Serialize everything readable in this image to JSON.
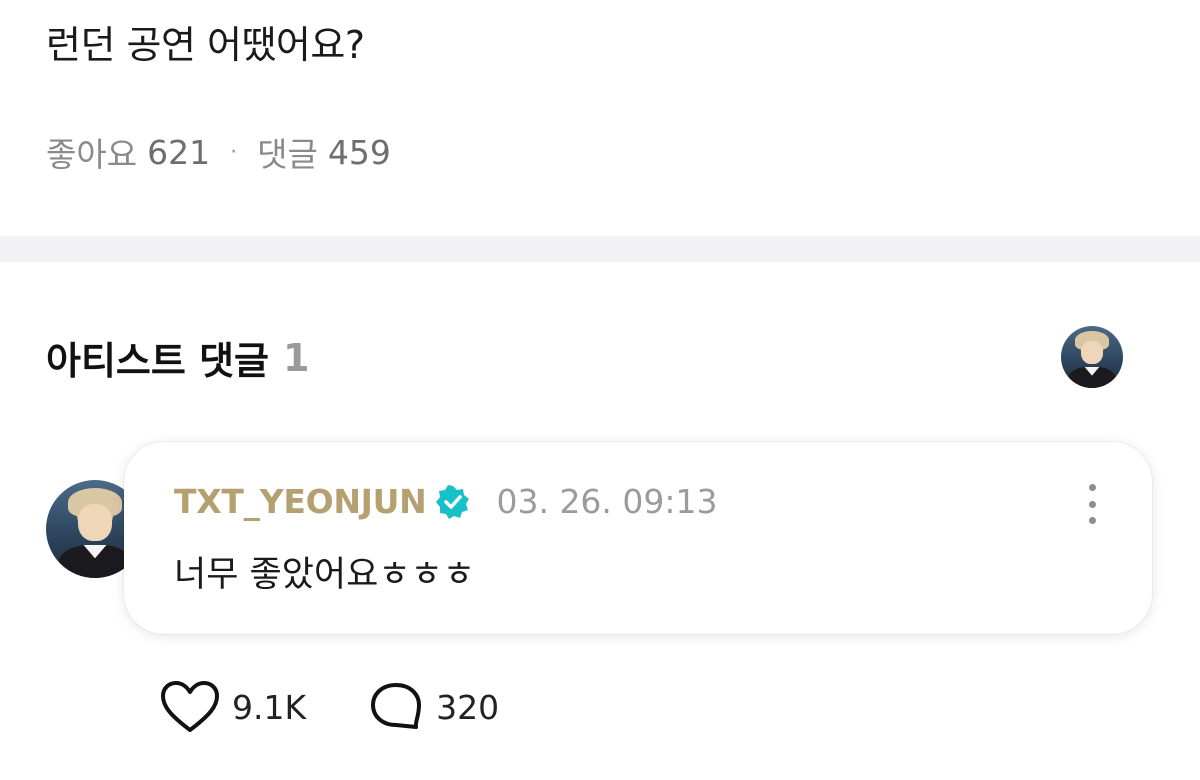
{
  "post": {
    "title": "런던 공연 어땠어요?",
    "likes_label": "좋아요",
    "likes_count": "621",
    "separator": "·",
    "comments_label": "댓글",
    "comments_count": "459"
  },
  "artist_section": {
    "title": "아티스트 댓글",
    "count": "1"
  },
  "comment": {
    "username": "TXT_YEONJUN",
    "timestamp": "03. 26. 09:13",
    "text": "너무 좋았어요ㅎㅎㅎ",
    "verified_icon": "verified-check-icon",
    "username_color": "#b5a06f",
    "verified_color": "#18c0c8"
  },
  "actions": {
    "like_count": "9.1K",
    "reply_count": "320",
    "like_icon": "heart-icon",
    "reply_icon": "speech-bubble-icon"
  }
}
